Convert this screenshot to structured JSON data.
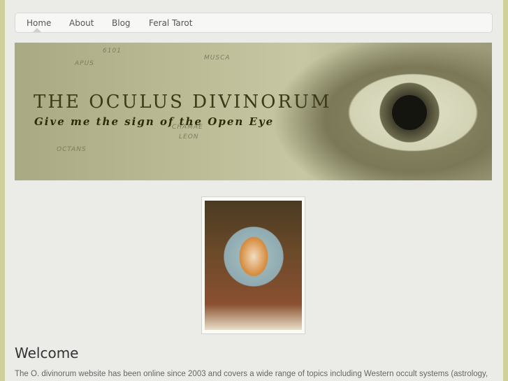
{
  "nav": {
    "items": [
      {
        "label": "Home"
      },
      {
        "label": "About"
      },
      {
        "label": "Blog"
      },
      {
        "label": "Feral Tarot"
      }
    ],
    "active": "Home"
  },
  "banner": {
    "title": "THE OCULUS DIVINORUM",
    "subtitle": "Give me the sign of the Open Eye",
    "star_labels": [
      "APUS",
      "MUSCA",
      "CHAMAE",
      "LEON",
      "OCTANS",
      "6101"
    ]
  },
  "main": {
    "heading": "Welcome",
    "intro": "The O. divinorum website has been online since 2003 and covers a wide range of topics including Western occult systems (astrology,"
  }
}
